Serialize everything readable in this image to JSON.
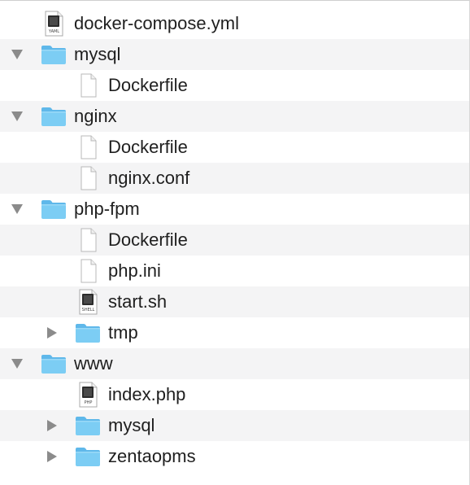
{
  "tree": {
    "items": [
      {
        "name": "docker-compose.yml",
        "kind": "file",
        "icon": "yaml-file-icon",
        "badge": "YAML",
        "depth": 1,
        "expanded": null
      },
      {
        "name": "mysql",
        "kind": "folder",
        "icon": "folder-icon",
        "depth": 1,
        "expanded": true
      },
      {
        "name": "Dockerfile",
        "kind": "file",
        "icon": "document-icon",
        "depth": 2,
        "expanded": null
      },
      {
        "name": "nginx",
        "kind": "folder",
        "icon": "folder-icon",
        "depth": 1,
        "expanded": true
      },
      {
        "name": "Dockerfile",
        "kind": "file",
        "icon": "document-icon",
        "depth": 2,
        "expanded": null
      },
      {
        "name": "nginx.conf",
        "kind": "file",
        "icon": "document-icon",
        "depth": 2,
        "expanded": null
      },
      {
        "name": "php-fpm",
        "kind": "folder",
        "icon": "folder-icon",
        "depth": 1,
        "expanded": true
      },
      {
        "name": "Dockerfile",
        "kind": "file",
        "icon": "document-icon",
        "depth": 2,
        "expanded": null
      },
      {
        "name": "php.ini",
        "kind": "file",
        "icon": "document-icon",
        "depth": 2,
        "expanded": null
      },
      {
        "name": "start.sh",
        "kind": "file",
        "icon": "shell-file-icon",
        "badge": "SHELL",
        "depth": 2,
        "expanded": null
      },
      {
        "name": "tmp",
        "kind": "folder",
        "icon": "folder-icon",
        "depth": 2,
        "expanded": false
      },
      {
        "name": "www",
        "kind": "folder",
        "icon": "folder-icon",
        "depth": 1,
        "expanded": true
      },
      {
        "name": "index.php",
        "kind": "file",
        "icon": "php-file-icon",
        "badge": "PHP",
        "depth": 2,
        "expanded": null
      },
      {
        "name": "mysql",
        "kind": "folder",
        "icon": "folder-icon",
        "depth": 2,
        "expanded": false
      },
      {
        "name": "zentaopms",
        "kind": "folder",
        "icon": "folder-icon",
        "depth": 2,
        "expanded": false
      }
    ]
  },
  "colors": {
    "folder_body": "#7ccdf4",
    "folder_tab": "#5fb8ea",
    "disclosure": "#8b8b8b",
    "row_alt": "#f4f4f5",
    "text": "#1f1f1f"
  }
}
